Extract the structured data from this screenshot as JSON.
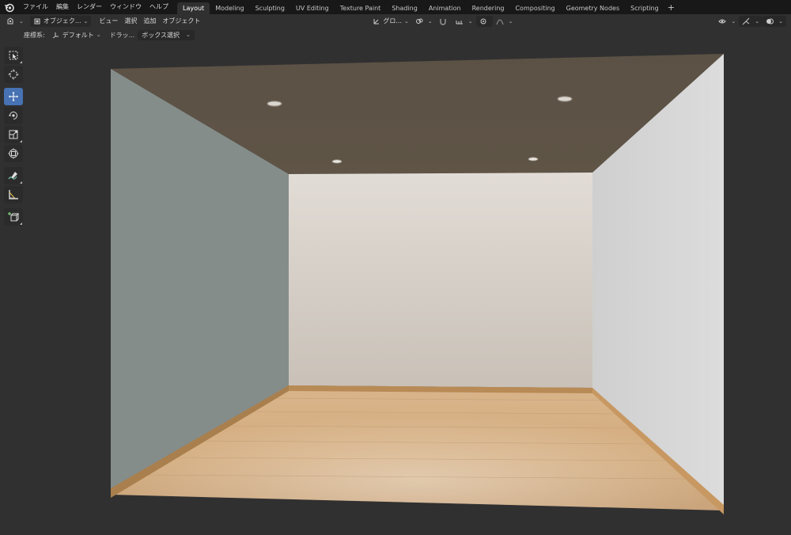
{
  "menu": {
    "items": [
      "ファイル",
      "編集",
      "レンダー",
      "ウィンドウ",
      "ヘルプ"
    ]
  },
  "workspaces": {
    "tabs": [
      "Layout",
      "Modeling",
      "Sculpting",
      "UV Editing",
      "Texture Paint",
      "Shading",
      "Animation",
      "Rendering",
      "Compositing",
      "Geometry Nodes",
      "Scripting"
    ],
    "active": "Layout",
    "add": "+"
  },
  "header": {
    "mode": "オブジェク...",
    "view": "ビュー",
    "select": "選択",
    "add": "追加",
    "object": "オブジェクト",
    "transform_orientation": "グロ..."
  },
  "tool_settings": {
    "orientation_label": "座標系:",
    "orientation_value": "デフォルト",
    "drag_label": "ドラッ...",
    "drag_value": "ボックス選択"
  },
  "toolbar": {
    "tools": [
      "select-box-icon",
      "cursor-icon",
      "move-icon",
      "rotate-icon",
      "scale-icon",
      "transform-icon",
      "annotate-icon",
      "measure-icon",
      "add-cube-icon"
    ],
    "active": "move-icon"
  },
  "colors": {
    "accent": "#4772b3",
    "topbar": "#181818",
    "background": "#303030",
    "ceiling": "#5e5345",
    "left_wall": "#848d8a",
    "back_wall": "#d4ccc6",
    "right_wall": "#d8d8d8",
    "floor": "#d2ad82",
    "baseboard": "#b88a55"
  }
}
